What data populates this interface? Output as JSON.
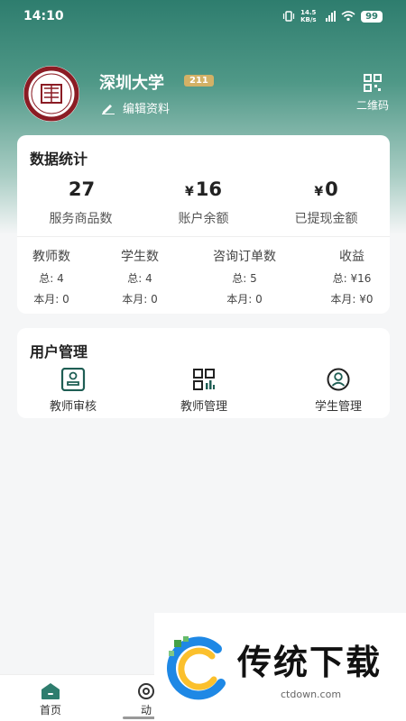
{
  "status_bar": {
    "time": "14:10",
    "net_speed": "14.5 KB/s",
    "battery": "99"
  },
  "profile": {
    "name": "深圳大学",
    "badge": "211",
    "edit_label": "编辑资料",
    "qr_label": "二维码"
  },
  "stats": {
    "title": "数据统计",
    "summary": [
      {
        "value": "27",
        "currency": "",
        "label": "服务商品数"
      },
      {
        "value": "16",
        "currency": "¥",
        "label": "账户余额"
      },
      {
        "value": "0",
        "currency": "¥",
        "label": "已提现金额"
      }
    ],
    "details": [
      {
        "head": "教师数",
        "total": "总: 4",
        "month": "本月: 0"
      },
      {
        "head": "学生数",
        "total": "总: 4",
        "month": "本月: 0"
      },
      {
        "head": "咨询订单数",
        "total": "总: 5",
        "month": "本月: 0"
      },
      {
        "head": "收益",
        "total": "总: ¥16",
        "month": "本月: ¥0"
      }
    ]
  },
  "user_mgmt": {
    "title": "用户管理",
    "items": [
      {
        "label": "教师审核",
        "icon": "teacher-review-icon"
      },
      {
        "label": "教师管理",
        "icon": "teacher-manage-icon"
      },
      {
        "label": "学生管理",
        "icon": "student-manage-icon"
      }
    ]
  },
  "tabbar": {
    "tabs": [
      {
        "label": "首页"
      },
      {
        "label": "动"
      }
    ]
  },
  "watermark": {
    "text": "传统下载",
    "url": "ctdown.com"
  },
  "colors": {
    "primary": "#2e7d6e",
    "badge": "#d3b166",
    "logo": "#8b1c24"
  }
}
